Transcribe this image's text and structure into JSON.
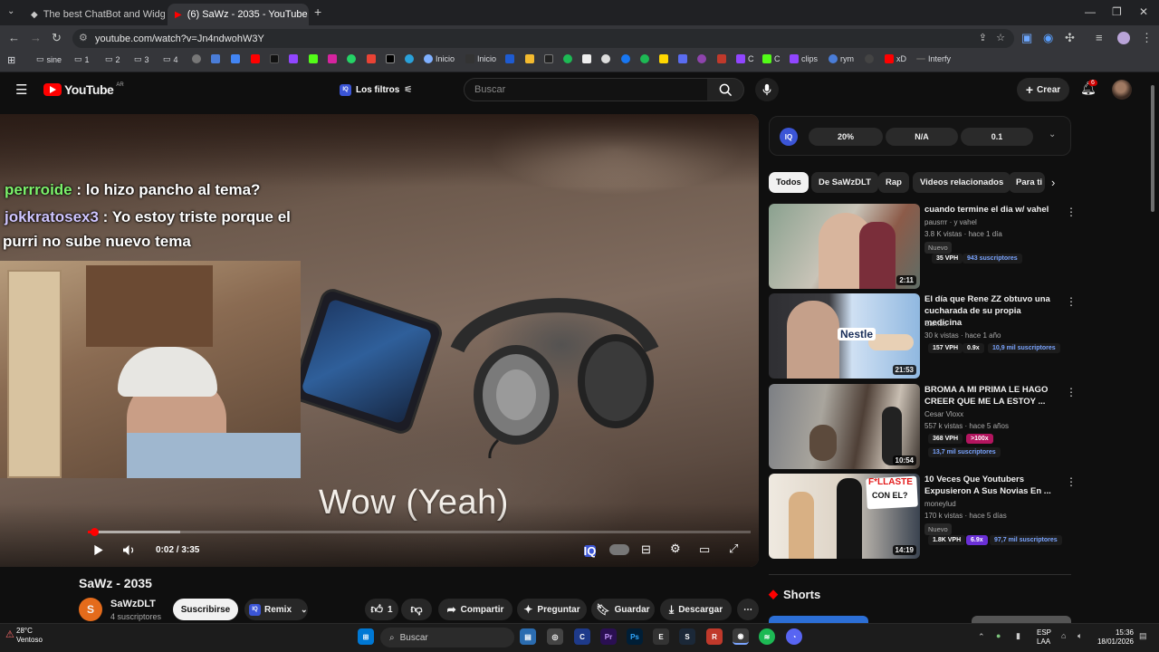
{
  "browser": {
    "tabs": [
      {
        "title": "The best ChatBot and Widgets f"
      },
      {
        "title": "(6) SaWz - 2035 - YouTube"
      }
    ],
    "url": "youtube.com/watch?v=Jn4ndwohW3Y",
    "bookmarks": [
      "sine",
      "1",
      "2",
      "3",
      "4",
      "Inicio",
      "Inicio",
      "C",
      "C",
      "clips",
      "rym",
      "xD",
      "Interfy"
    ]
  },
  "header": {
    "logo_text": "YouTube",
    "country_code": "AR",
    "filters_label": "Los filtros",
    "search_placeholder": "Buscar",
    "create_label": "Crear",
    "notifications_count": "6"
  },
  "player": {
    "chat": [
      {
        "user": "perrroide",
        "message": " : lo hizo pancho al tema?"
      },
      {
        "user": "jokkratosex3",
        "message": " : Yo estoy triste porque el",
        "continuation": "purri no sube nuevo tema"
      }
    ],
    "lyric": "Wow (Yeah)",
    "time": "0:02 / 3:35",
    "progress_fraction": 0.0093,
    "buffered_fraction": 0.14
  },
  "video": {
    "title": "SaWz - 2035",
    "channel_initial": "S",
    "channel_name": "SaWzDLT",
    "subscribers": "4 suscriptores",
    "subscribe_label": "Suscribirse",
    "remix_label": "Remix",
    "likes": "1",
    "share_label": "Compartir",
    "ask_label": "Preguntar",
    "save_label": "Guardar",
    "download_label": "Descargar"
  },
  "metrics": {
    "values": [
      "20%",
      "N/A",
      "0.1"
    ]
  },
  "chips": [
    "Todos",
    "De SaWzDLT",
    "Rap",
    "Videos relacionados",
    "Para ti"
  ],
  "recommendations": [
    {
      "title": "cuando termine el dia w/ vahel",
      "channel": "pausrrr · y vahel",
      "meta": "3.8 K vistas · hace 1 día",
      "nuevo": "Nuevo",
      "vph": "35 VPH",
      "mult": "",
      "subs": "943 suscriptores",
      "duration": "2:11"
    },
    {
      "title": "El día que Rene ZZ obtuvo una cucharada de su propia medicina",
      "channel": "Samsa",
      "meta": "30 k vistas · hace 1 año",
      "nuevo": "",
      "vph": "157 VPH",
      "mult": "0.9x",
      "subs": "10,9 mil suscriptores",
      "duration": "21:53"
    },
    {
      "title": "BROMA A MI PRIMA LE HAGO CREER QUE ME LA ESTOY ...",
      "channel": "Cesar Vloxx",
      "meta": "557 k vistas · hace 5 años",
      "nuevo": "",
      "vph": "368 VPH",
      "mult": ">100x",
      "subs": "13,7 mil suscriptores",
      "duration": "10:54"
    },
    {
      "title": "10 Veces Que Youtubers Expusieron A Sus Novias En ...",
      "channel": "moneylud",
      "meta": "170 k vistas · hace 5 días",
      "nuevo": "Nuevo",
      "vph": "1.8K VPH",
      "mult": "6.9x",
      "subs": "97,7 mil suscriptores",
      "duration": "14:19"
    }
  ],
  "thumbnail_text": {
    "nestle": "Nestle",
    "fallaste": "F*LLASTE",
    "con_el": "CON EL?"
  },
  "shorts_label": "Shorts",
  "taskbar": {
    "temp": "28°C",
    "weather": "Ventoso",
    "search": "Buscar",
    "lang": "ESP",
    "region": "LAA",
    "time": "15:36",
    "date": "18/01/2026"
  },
  "colors": {
    "accent_red": "#ff0000",
    "iq_blue": "#3b55d6"
  }
}
